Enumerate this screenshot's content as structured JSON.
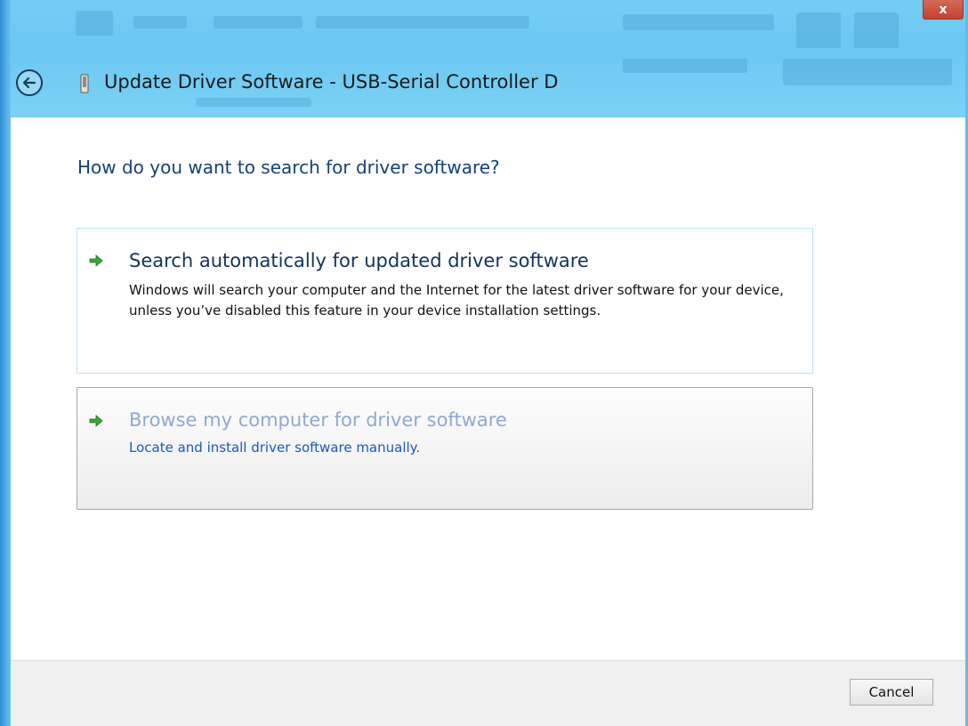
{
  "window": {
    "title": "Update Driver Software - USB-Serial Controller D",
    "close_label": "x"
  },
  "main": {
    "question": "How do you want to search for driver software?",
    "options": [
      {
        "heading": "Search automatically for updated driver software",
        "description": "Windows will search your computer and the Internet for the latest driver software for your device, unless you’ve disabled this feature in your device installation settings."
      },
      {
        "heading": "Browse my computer for driver software",
        "description": "Locate and install driver software manually."
      }
    ]
  },
  "footer": {
    "cancel_label": "Cancel"
  },
  "icons": {
    "back": "back-arrow-icon",
    "device": "usb-device-icon",
    "option_arrow": "green-arrow-icon"
  },
  "colors": {
    "titlebar": "#6cc7f1",
    "question_text": "#16407a",
    "browse_heading": "#8fa8d6",
    "browse_link": "#1c56c8",
    "close_button": "#c4412f"
  }
}
